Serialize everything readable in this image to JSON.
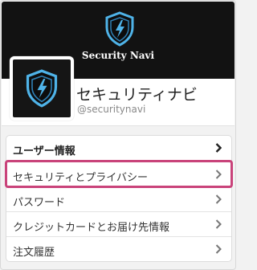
{
  "banner": {
    "title": "Security Navi",
    "logo_icon": "shield-lightning-icon"
  },
  "profile": {
    "name": "セキュリティナビ",
    "handle": "@securitynavi",
    "avatar_icon": "shield-lightning-icon"
  },
  "menu": {
    "items": [
      {
        "label": "ユーザー情報",
        "style": "bold"
      },
      {
        "label": "セキュリティとプライバシー",
        "highlighted": true
      },
      {
        "label": "パスワード"
      },
      {
        "label": "クレジットカードとお届け先情報"
      },
      {
        "label": "注文履歴"
      }
    ],
    "chevron_icon": "chevron-right-icon"
  },
  "colors": {
    "highlight_border": "#c9437a",
    "banner_bg": "#121212",
    "shield_blue": "#4fb3e8"
  }
}
